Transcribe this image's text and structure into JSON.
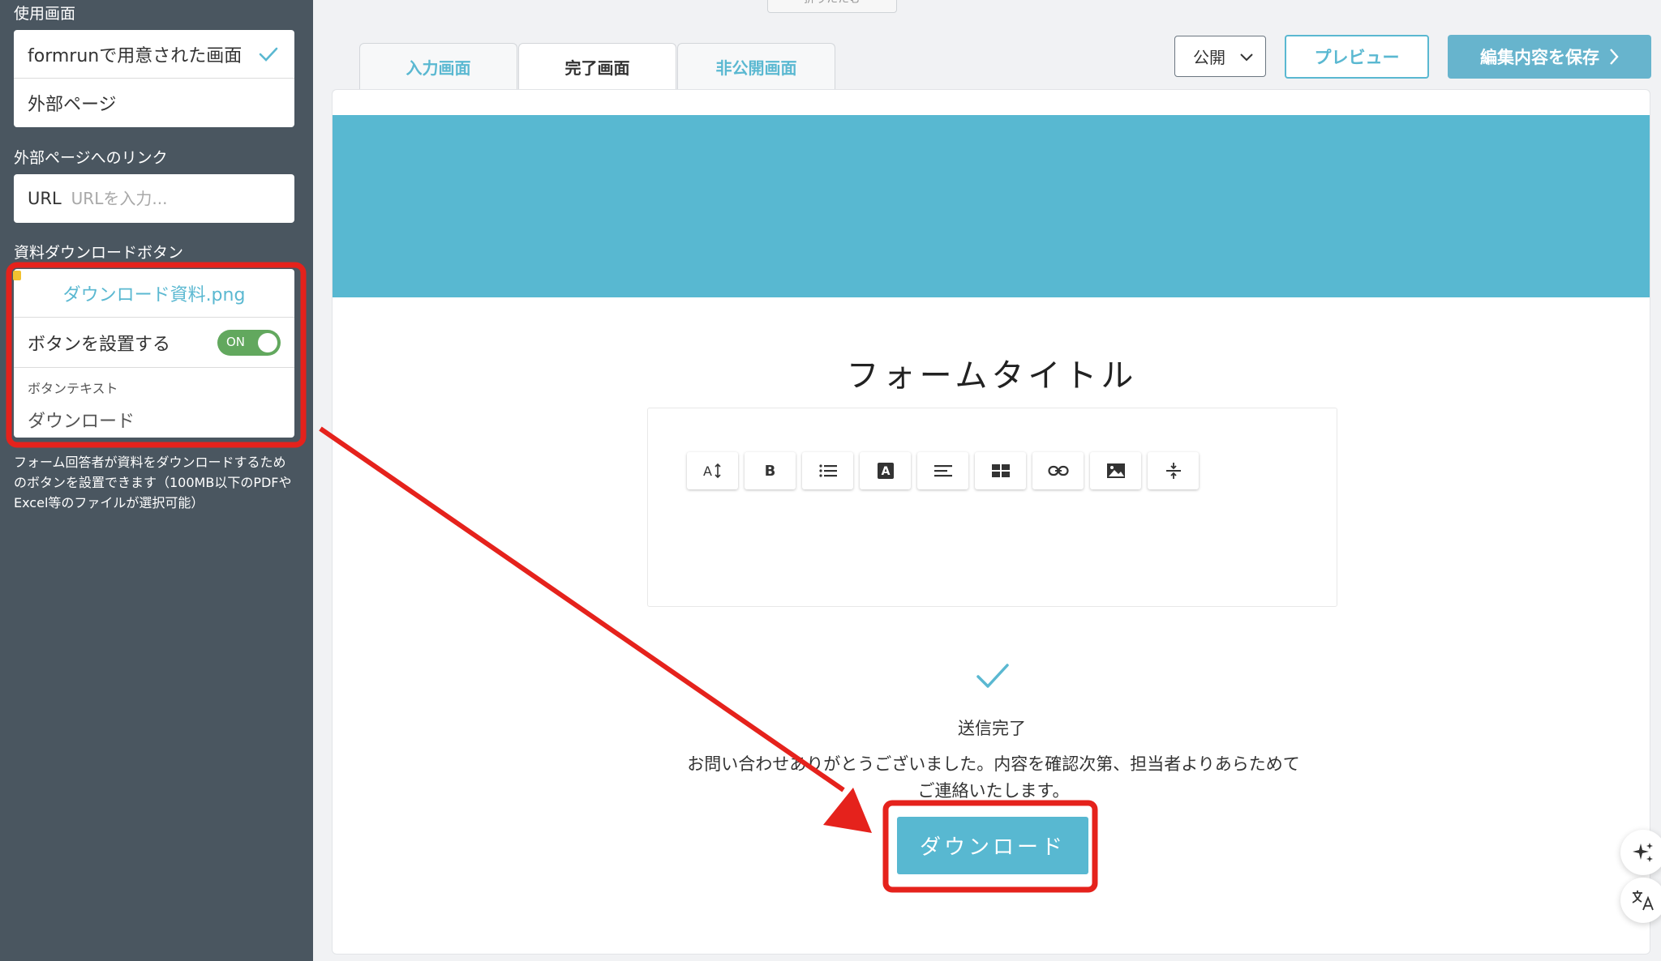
{
  "sidebar": {
    "usage_screen_label": "使用画面",
    "options": [
      {
        "label": "formrunで用意された画面",
        "selected": true
      },
      {
        "label": "外部ページ",
        "selected": false
      }
    ],
    "external_link_label": "外部ページへのリンク",
    "url": {
      "prefix": "URL",
      "placeholder": "URLを入力...",
      "value": ""
    },
    "download_button_section_label": "資料ダウンロードボタン",
    "download_file_name": "ダウンロード資料.png",
    "place_button_label": "ボタンを設置する",
    "toggle": {
      "text": "ON",
      "on": true,
      "color": "#62a85e"
    },
    "button_text_label": "ボタンテキスト",
    "button_text_value": "ダウンロード",
    "help_text": "フォーム回答者が資料をダウンロードするためのボタンを設置できます（100MB以下のPDFやExcel等のファイルが選択可能）"
  },
  "header": {
    "collapsed_tab_text": "折りたたむ",
    "tabs": [
      {
        "label": "入力画面",
        "active": false
      },
      {
        "label": "完了画面",
        "active": true
      },
      {
        "label": "非公開画面",
        "active": false
      }
    ],
    "publish_select": {
      "value": "公開"
    },
    "preview_label": "プレビュー",
    "save_label": "編集内容を保存"
  },
  "preview": {
    "banner_color": "#58b8d1",
    "form_title": "フォームタイトル",
    "toolbar_icons": [
      "font-size-icon",
      "bold-icon",
      "list-icon",
      "text-color-icon",
      "align-icon",
      "table-icon",
      "link-icon",
      "image-icon",
      "divider-icon"
    ],
    "bold_glyph": "B",
    "text_color_glyph": "A",
    "done_title": "送信完了",
    "done_message": "お問い合わせありがとうございました。内容を確認次第、担当者よりあらためてご連絡いたします。",
    "download_button_label": "ダウンロード"
  },
  "colors": {
    "accent": "#5ab8d1",
    "sidebar_bg": "#4a5660",
    "annotation_red": "#e5221c"
  }
}
